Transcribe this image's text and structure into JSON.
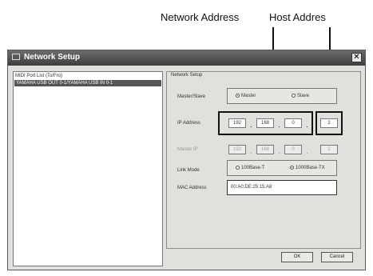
{
  "callouts": {
    "network_address": "Network Address",
    "host_address": "Host Addres"
  },
  "window": {
    "title": "Network Setup",
    "close_label": "✕"
  },
  "port_list": {
    "header": "MIDI Port List (To/Fro)",
    "rows": [
      "YAMAHA USB OUT 0-1/YAMAHA USB IN 0-1"
    ]
  },
  "network_setup": {
    "group_label": "Network Setup",
    "master_slave": {
      "label": "Master/Slave",
      "options": [
        "Master",
        "Slave"
      ],
      "selected": "Master"
    },
    "ip_address": {
      "label": "IP Address",
      "octets": [
        "192",
        "168",
        "0",
        "2"
      ]
    },
    "master_ip": {
      "label": "Master IP",
      "octets": [
        "192",
        "168",
        "0",
        "2"
      ]
    },
    "link_mode": {
      "label": "Link Mode",
      "options": [
        "100Base-T",
        "1000Base-TX"
      ],
      "selected": "1000Base-TX"
    },
    "mac_address": {
      "label": "MAC Address",
      "value": "00:A0:DE:25:15:A8"
    }
  },
  "buttons": {
    "ok": "OK",
    "cancel": "Cancel"
  }
}
